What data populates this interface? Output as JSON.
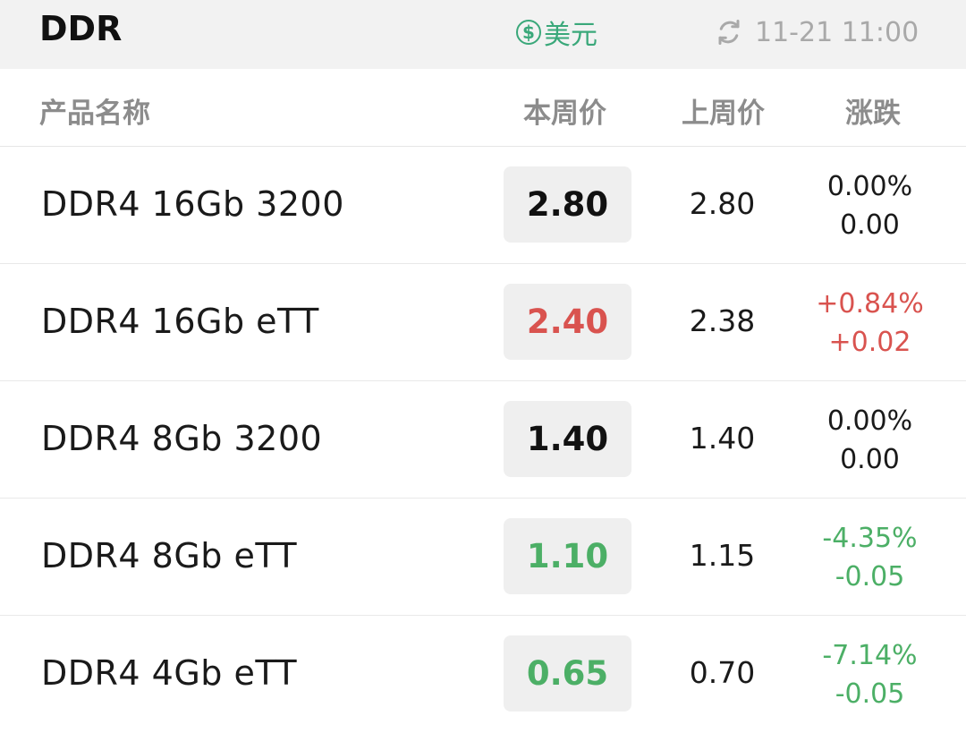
{
  "header": {
    "title": "DDR",
    "currency_label": "美元",
    "currency_icon": "dollar-circle-icon",
    "refresh_icon": "refresh-icon",
    "timestamp": "11-21 11:00"
  },
  "table": {
    "columns": [
      "产品名称",
      "本周价",
      "上周价",
      "涨跌"
    ],
    "rows": [
      {
        "name": "DDR4 16Gb 3200",
        "current": "2.80",
        "previous": "2.80",
        "change_pct": "0.00%",
        "change_abs": "0.00",
        "trend": "flat"
      },
      {
        "name": "DDR4 16Gb eTT",
        "current": "2.40",
        "previous": "2.38",
        "change_pct": "+0.84%",
        "change_abs": "+0.02",
        "trend": "up"
      },
      {
        "name": "DDR4 8Gb 3200",
        "current": "1.40",
        "previous": "1.40",
        "change_pct": "0.00%",
        "change_abs": "0.00",
        "trend": "flat"
      },
      {
        "name": "DDR4 8Gb eTT",
        "current": "1.10",
        "previous": "1.15",
        "change_pct": "-4.35%",
        "change_abs": "-0.05",
        "trend": "down"
      },
      {
        "name": "DDR4 4Gb eTT",
        "current": "0.65",
        "previous": "0.70",
        "change_pct": "-7.14%",
        "change_abs": "-0.05",
        "trend": "down"
      }
    ]
  },
  "colors": {
    "accent_green": "#3aa87a",
    "up_red": "#d9534f",
    "down_green": "#4caf66",
    "muted_gray": "#a9a9a9"
  }
}
